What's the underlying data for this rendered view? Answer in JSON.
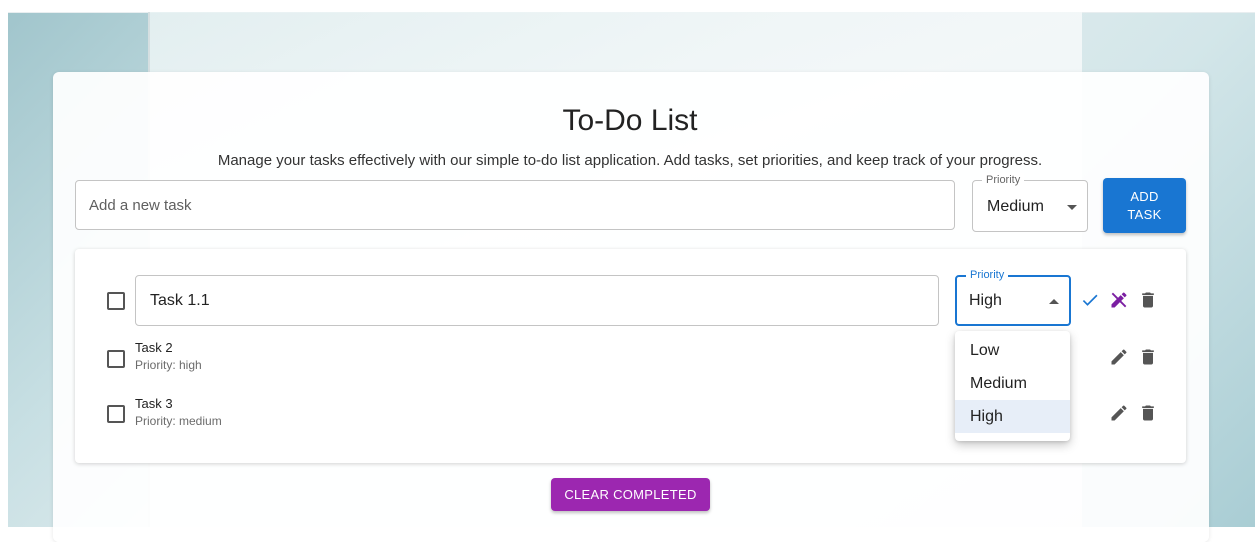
{
  "app": {
    "title": "To-Do List",
    "subtitle": "Manage your tasks effectively with our simple to-do list application. Add tasks, set priorities, and keep track of your progress."
  },
  "new_task": {
    "placeholder": "Add a new task",
    "value": "",
    "priority_label": "Priority",
    "priority_value": "Medium",
    "add_label_line1": "ADD",
    "add_label_line2": "TASK"
  },
  "tasks": [
    {
      "name": "Task 1.1",
      "completed": false,
      "editing": true,
      "priority_label": "Priority",
      "priority_value": "High",
      "icons": [
        "check-icon",
        "cancel-edit-icon",
        "delete-icon"
      ]
    },
    {
      "name": "Task 2",
      "priority_text": "Priority: high",
      "completed": false,
      "icons": [
        "edit-icon",
        "delete-icon"
      ]
    },
    {
      "name": "Task 3",
      "priority_text": "Priority: medium",
      "completed": false,
      "icons": [
        "edit-icon",
        "delete-icon"
      ]
    }
  ],
  "priority_menu": {
    "open": true,
    "options": [
      "Low",
      "Medium",
      "High"
    ],
    "selected": "High"
  },
  "clear_completed_label": "CLEAR COMPLETED",
  "colors": {
    "primary": "#1976d2",
    "secondary": "#9c27b0",
    "edit_cancel": "#7b1fa2",
    "icon": "#555555"
  }
}
